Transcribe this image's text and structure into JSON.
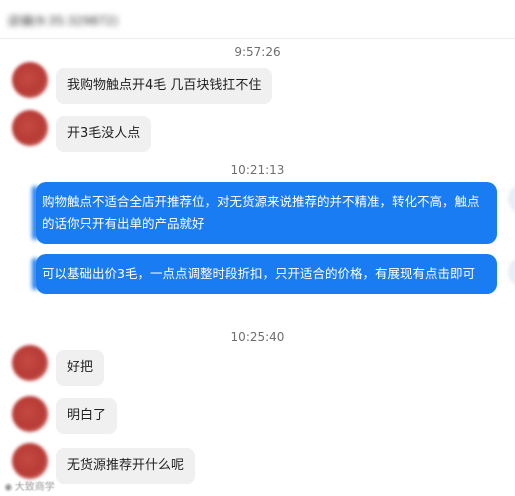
{
  "header": {
    "title": "店铺(9:35:329872)"
  },
  "timestamps": [
    "9:57:26",
    "10:21:13",
    "10:25:40"
  ],
  "messages": {
    "m1": "我购物触点开4毛 几百块钱扛不住",
    "m2": "开3毛没人点",
    "r1": "购物触点不适合全店开推荐位，对无货源来说推荐的并不精准，转化不高，触点的话你只开有出单的产品就好",
    "r2": "可以基础出价3毛，一点点调整时段折扣，只开适合的价格，有展现有点击即可",
    "m3": "好把",
    "m4": "明白了",
    "m5": "无货源推荐开什么呢"
  },
  "watermark": {
    "icon": "weibo-icon",
    "text": "大致商学"
  },
  "colors": {
    "outgoing_bubble": "#1a7cf2",
    "incoming_bubble": "#f0f0f0",
    "avatar": "#b83b36"
  }
}
